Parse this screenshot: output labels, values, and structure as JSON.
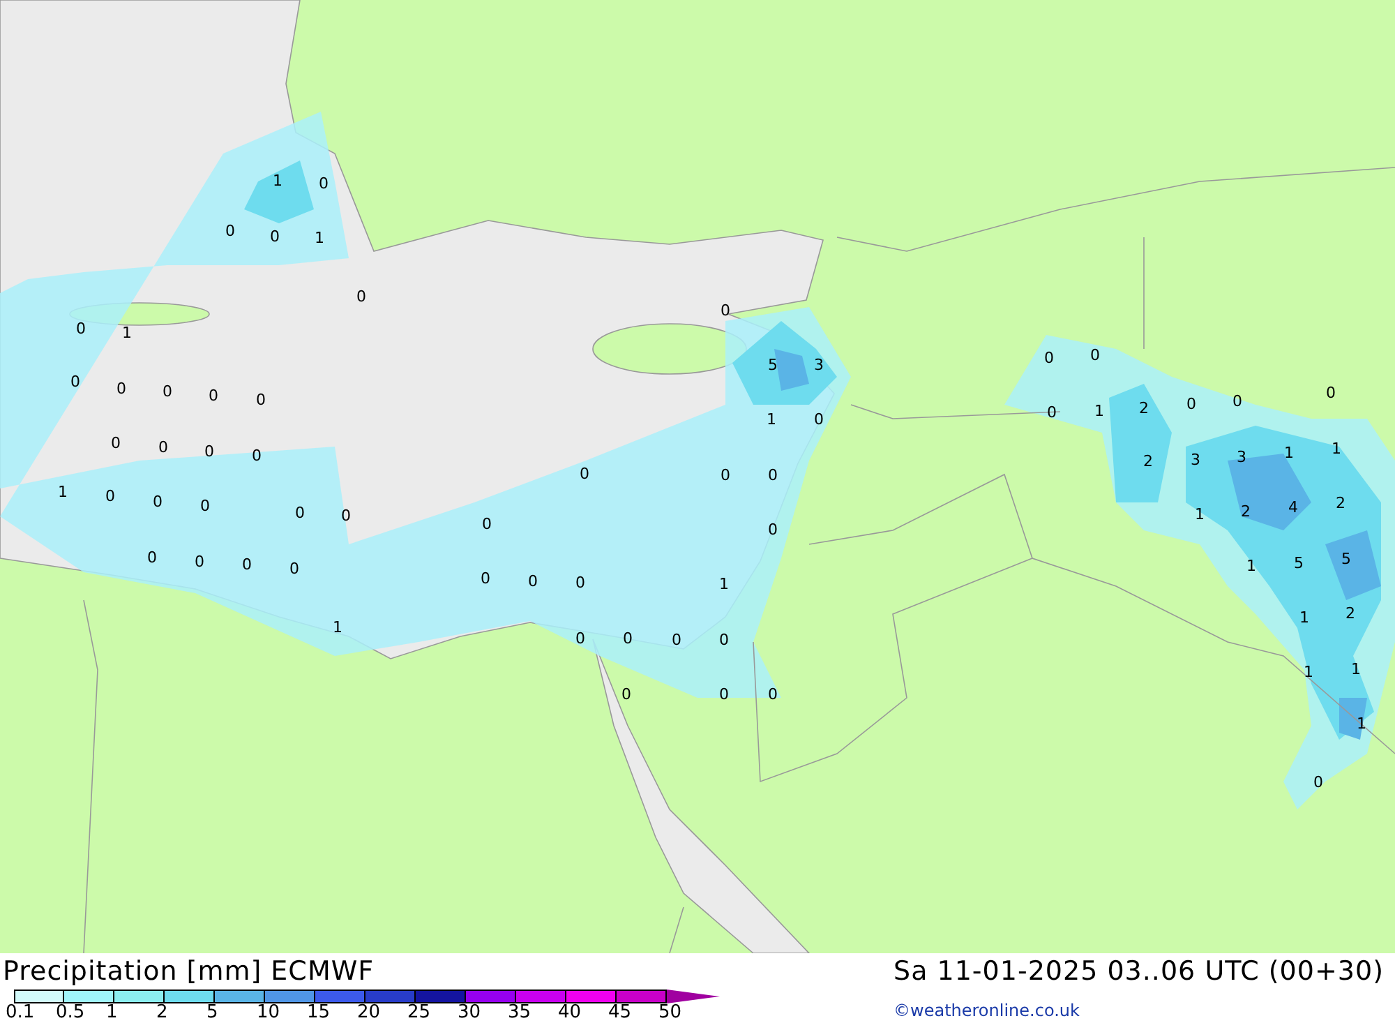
{
  "map": {
    "values": [
      "1",
      "0",
      "0",
      "0",
      "1",
      "0",
      "0",
      "1",
      "0",
      "5",
      "3",
      "1",
      "0",
      "0",
      "0",
      "0",
      "0",
      "0",
      "0",
      "0",
      "0",
      "0",
      "0",
      "0",
      "0",
      "1",
      "0",
      "0",
      "0",
      "0",
      "0",
      "0",
      "0",
      "0",
      "0",
      "0",
      "0",
      "0",
      "0",
      "0",
      "1",
      "1",
      "0",
      "0",
      "0",
      "0",
      "0",
      "0",
      "0",
      "0",
      "0",
      "0",
      "0",
      "1",
      "2",
      "0",
      "0",
      "2",
      "3",
      "3",
      "1",
      "1",
      "1",
      "2",
      "4",
      "2",
      "1",
      "5",
      "5",
      "1",
      "2",
      "1",
      "1",
      "1",
      "0"
    ]
  },
  "legend": {
    "title": "Precipitation [mm] ECMWF",
    "bins": [
      {
        "color": "#d2fafa"
      },
      {
        "color": "#a0f5fa"
      },
      {
        "color": "#8ceef0"
      },
      {
        "color": "#6edcee"
      },
      {
        "color": "#5ab4e6"
      },
      {
        "color": "#5096e6"
      },
      {
        "color": "#3c5aeb"
      },
      {
        "color": "#283cc8"
      },
      {
        "color": "#1414a0"
      },
      {
        "color": "#9600f0"
      },
      {
        "color": "#c800f0"
      },
      {
        "color": "#f000f0"
      },
      {
        "color": "#c800c8"
      }
    ],
    "ticks": [
      "0.1",
      "0.5",
      "1",
      "2",
      "5",
      "10",
      "15",
      "20",
      "25",
      "30",
      "35",
      "40",
      "45",
      "50"
    ]
  },
  "valid_time": "Sa 11-01-2025 03..06 UTC (00+30)",
  "credit": "©weatheronline.co.uk"
}
